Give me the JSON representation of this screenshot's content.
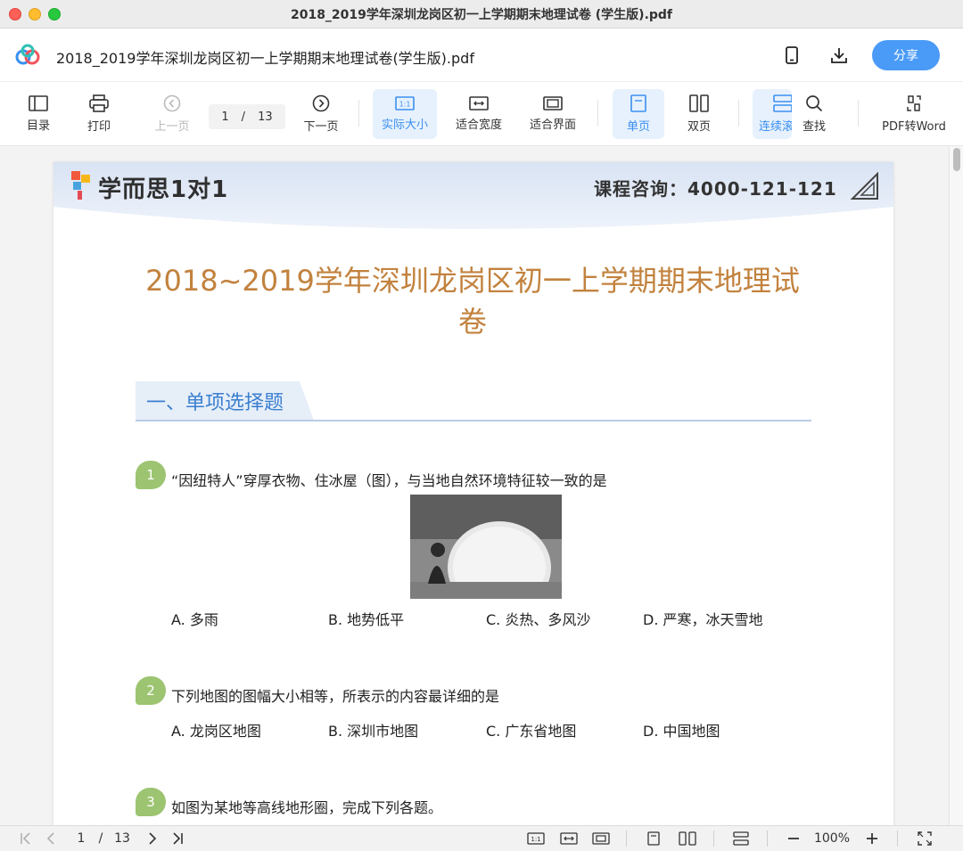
{
  "window": {
    "title": "2018_2019学年深圳龙岗区初一上学期期末地理试卷 (学生版).pdf"
  },
  "header": {
    "document_name": "2018_2019学年深圳龙岗区初一上学期期末地理试卷(学生版).pdf",
    "share_label": "分享"
  },
  "toolbar": {
    "toc": "目录",
    "print": "打印",
    "prev_page": "上一页",
    "page_current": "1",
    "page_sep": "/",
    "page_total": "13",
    "next_page": "下一页",
    "actual_size": "实际大小",
    "fit_width": "适合宽度",
    "fit_page": "适合界面",
    "single_page": "单页",
    "double_page": "双页",
    "continuous": "连续滚",
    "search": "查找",
    "pdf_to_word": "PDF转Word"
  },
  "pdf": {
    "brand": "学而思1对1",
    "consult": "课程咨询：4000-121-121",
    "title_line1": "2018~2019学年深圳龙岗区初一上学期期末地理试",
    "title_line2": "卷",
    "section": "一、单项选择题",
    "questions": [
      {
        "num": "1",
        "text": "“因纽特人”穿厚衣物、住冰屋（图），与当地自然环境特征较一致的是",
        "options": [
          "A.  多雨",
          "B.  地势低平",
          "C.  炎热、多风沙",
          "D.  严寒，冰天雪地"
        ]
      },
      {
        "num": "2",
        "text": "下列地图的图幅大小相等，所表示的内容最详细的是",
        "options": [
          "A.  龙岗区地图",
          "B.  深圳市地图",
          "C.  广东省地图",
          "D.  中国地图"
        ]
      },
      {
        "num": "3",
        "text": "如图为某地等高线地形圈，完成下列各题。"
      }
    ]
  },
  "bottombar": {
    "page_current": "1",
    "page_sep": "/",
    "page_total": "13",
    "zoom": "100%"
  },
  "colors": {
    "accent": "#4a9bf7",
    "title_orange": "#c2823e",
    "section_blue": "#3b7fd0",
    "badge_green": "#9cc471"
  }
}
